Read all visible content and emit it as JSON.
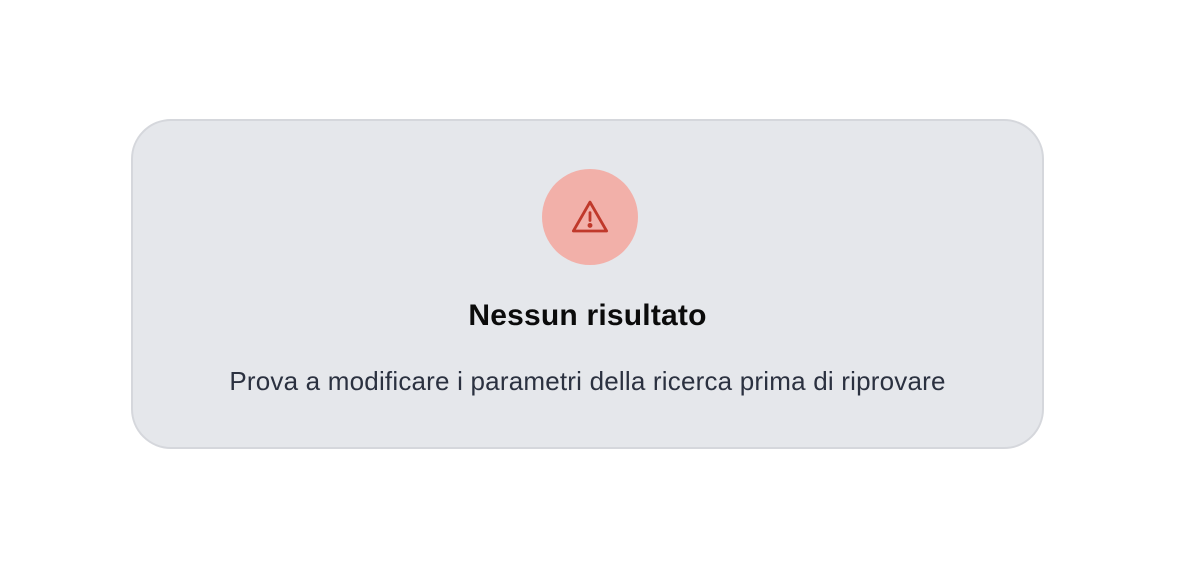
{
  "empty_state": {
    "icon": "warning-icon",
    "title": "Nessun risultato",
    "message": "Prova a modificare i parametri della ricerca prima di riprovare"
  },
  "colors": {
    "page_background": "#ffffff",
    "card_background": "#e5e7eb",
    "card_border": "#d5d7dc",
    "icon_circle": "#f2b0a9",
    "icon_stroke": "#c0392b",
    "title_text": "#0b0b0b",
    "message_text": "#2b3140"
  }
}
